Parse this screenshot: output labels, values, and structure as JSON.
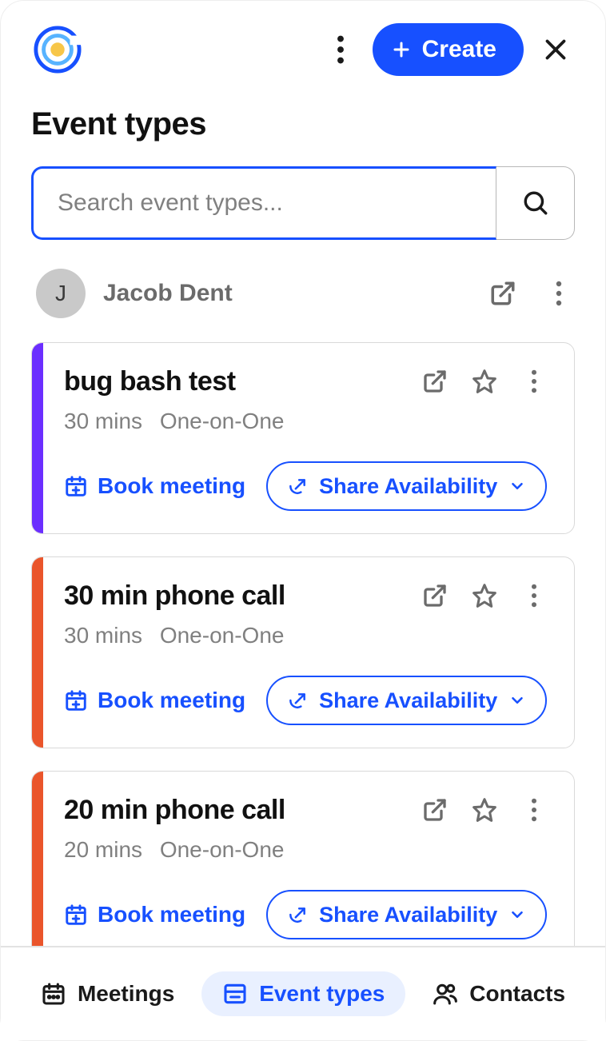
{
  "header": {
    "create_label": "Create"
  },
  "page_title": "Event types",
  "search": {
    "placeholder": "Search event types..."
  },
  "owner": {
    "initial": "J",
    "name": "Jacob Dent"
  },
  "events": [
    {
      "title": "bug bash test",
      "duration": "30 mins",
      "type": "One-on-One",
      "stripe_color": "#6b2eff",
      "book_label": "Book meeting",
      "share_label": "Share Availability"
    },
    {
      "title": "30 min phone call",
      "duration": "30 mins",
      "type": "One-on-One",
      "stripe_color": "#ea552b",
      "book_label": "Book meeting",
      "share_label": "Share Availability"
    },
    {
      "title": "20 min phone call",
      "duration": "20 mins",
      "type": "One-on-One",
      "stripe_color": "#ea552b",
      "book_label": "Book meeting",
      "share_label": "Share Availability"
    }
  ],
  "nav": {
    "meetings": "Meetings",
    "event_types": "Event types",
    "contacts": "Contacts"
  }
}
